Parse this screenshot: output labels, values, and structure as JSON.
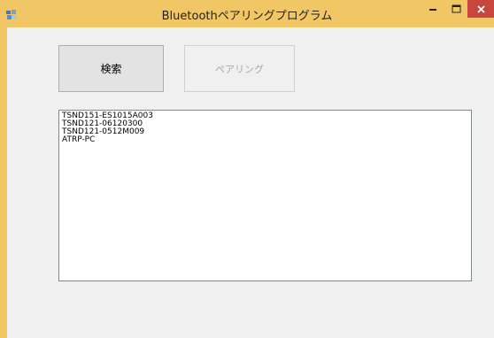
{
  "window": {
    "title": "Bluetoothペアリングプログラム",
    "accent_color": "#f0c764",
    "close_color": "#c7463d"
  },
  "buttons": {
    "search_label": "検索",
    "pairing_label": "ペアリング"
  },
  "devices": [
    "TSND151-ES1015A003",
    "TSND121-06120300",
    "TSND121-0512M009",
    "ATRP-PC"
  ],
  "icons": {
    "app": "app-window-icon",
    "minimize": "minimize-icon",
    "maximize": "maximize-icon",
    "close": "close-icon"
  }
}
